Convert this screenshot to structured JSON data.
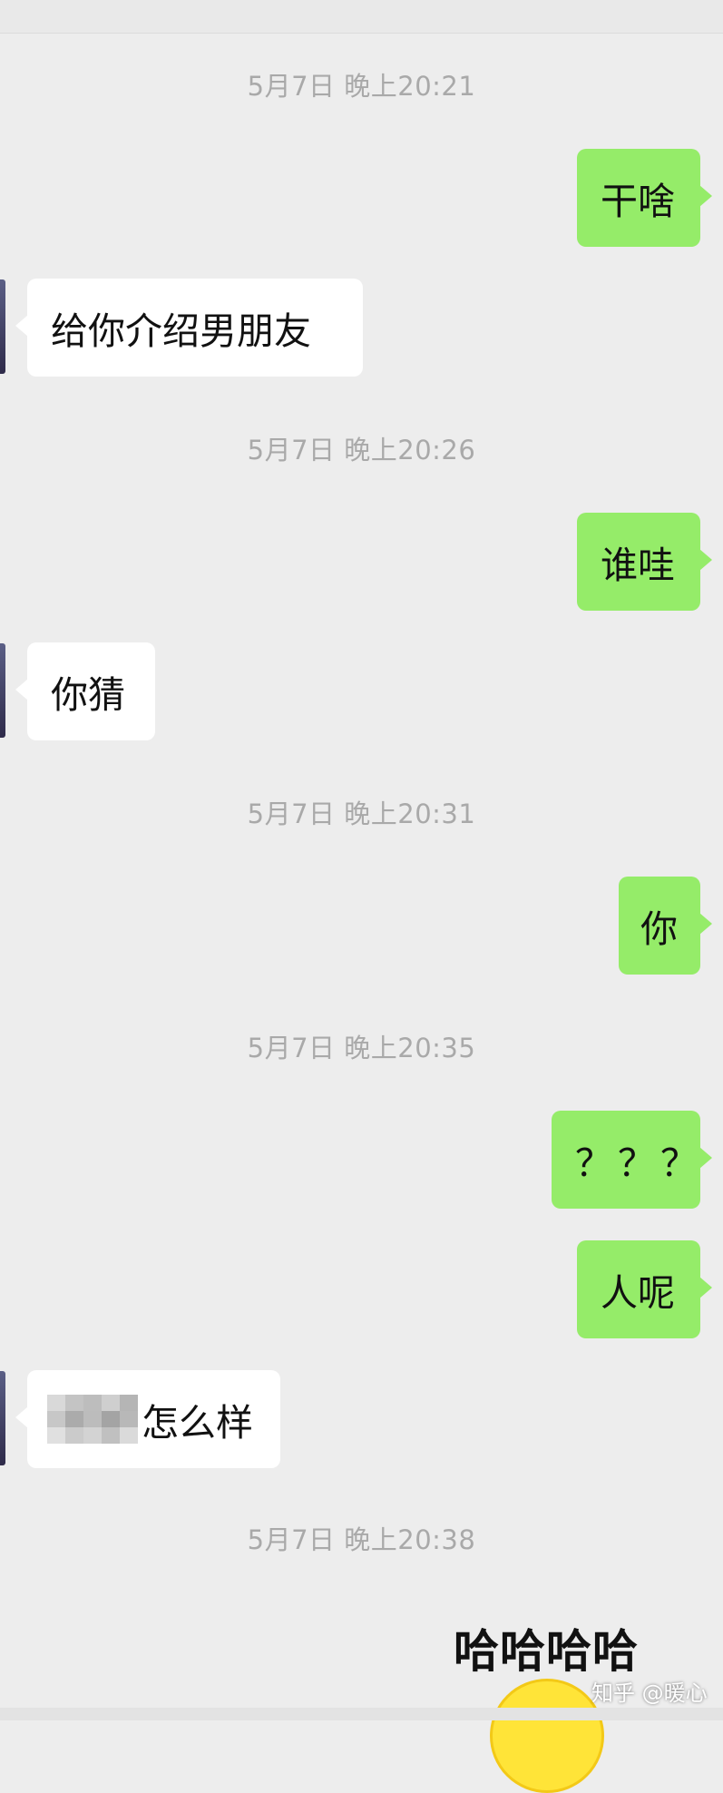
{
  "timestamps": [
    "5月7日 晚上20:21",
    "5月7日 晚上20:26",
    "5月7日 晚上20:31",
    "5月7日 晚上20:35",
    "5月7日 晚上20:38"
  ],
  "messages": [
    {
      "from": "me",
      "text": "干啥"
    },
    {
      "from": "them",
      "text": "给你介绍男朋友"
    },
    {
      "from": "me",
      "text": "谁哇"
    },
    {
      "from": "them",
      "text": "你猜"
    },
    {
      "from": "me",
      "text": "你"
    },
    {
      "from": "me",
      "text": "？？？"
    },
    {
      "from": "me",
      "text": "人呢"
    },
    {
      "from": "them",
      "text": "怎么样"
    }
  ],
  "sticker_text": "哈哈哈哈",
  "watermark": "知乎 @暖心",
  "colors": {
    "me_bubble": "#95ec69",
    "them_bubble": "#ffffff",
    "background": "#ededed",
    "timestamp": "#a9a9a9"
  }
}
